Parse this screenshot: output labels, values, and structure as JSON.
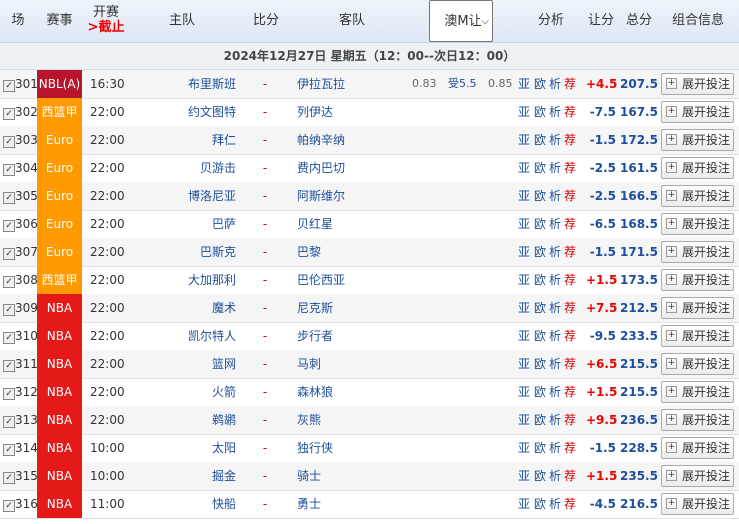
{
  "header": {
    "col_seq": "场",
    "col_league": "赛事",
    "col_kickoff_1": "开赛",
    "col_kickoff_2": ">截止",
    "col_home": "主队",
    "col_score": "比分",
    "col_away": "客队",
    "odds_select": "澳M让",
    "col_analysis": "分析",
    "col_handicap": "让分",
    "col_total": "总分",
    "col_combo": "组合信息"
  },
  "date_band": "2024年12月27日 星期五（12：00--次日12：00）",
  "colors": {
    "nbl": "#b8142b",
    "euro": "#ff9900",
    "xlj": "#ff9900",
    "nba": "#e61919"
  },
  "rows": [
    {
      "num": "301",
      "league": "NBL(A)",
      "color": "#b8142b",
      "time": "16:30",
      "home": "布里斯班",
      "score": "-",
      "away": "伊拉瓦拉",
      "odds_l": "0.83",
      "odds_m": "受5.5",
      "odds_r": "0.85",
      "a1": "亚",
      "a2": "欧",
      "a3": "析",
      "a4": "荐",
      "hc": "+4.5",
      "total": "207.5",
      "btn": "展开投注"
    },
    {
      "num": "302",
      "league": "西篮甲",
      "color": "#ff9900",
      "time": "22:00",
      "home": "约文图特",
      "score": "-",
      "away": "列伊达",
      "odds_l": "",
      "odds_m": "",
      "odds_r": "",
      "a1": "亚",
      "a2": "欧",
      "a3": "析",
      "a4": "荐",
      "hc": "-7.5",
      "total": "167.5",
      "btn": "展开投注"
    },
    {
      "num": "303",
      "league": "Euro",
      "color": "#ff9900",
      "time": "22:00",
      "home": "拜仁",
      "score": "-",
      "away": "帕纳辛纳",
      "odds_l": "",
      "odds_m": "",
      "odds_r": "",
      "a1": "亚",
      "a2": "欧",
      "a3": "析",
      "a4": "荐",
      "hc": "-1.5",
      "total": "172.5",
      "btn": "展开投注"
    },
    {
      "num": "304",
      "league": "Euro",
      "color": "#ff9900",
      "time": "22:00",
      "home": "贝游击",
      "score": "-",
      "away": "费内巴切",
      "odds_l": "",
      "odds_m": "",
      "odds_r": "",
      "a1": "亚",
      "a2": "欧",
      "a3": "析",
      "a4": "荐",
      "hc": "-2.5",
      "total": "161.5",
      "btn": "展开投注"
    },
    {
      "num": "305",
      "league": "Euro",
      "color": "#ff9900",
      "time": "22:00",
      "home": "博洛尼亚",
      "score": "-",
      "away": "阿斯维尔",
      "odds_l": "",
      "odds_m": "",
      "odds_r": "",
      "a1": "亚",
      "a2": "欧",
      "a3": "析",
      "a4": "荐",
      "hc": "-2.5",
      "total": "166.5",
      "btn": "展开投注"
    },
    {
      "num": "306",
      "league": "Euro",
      "color": "#ff9900",
      "time": "22:00",
      "home": "巴萨",
      "score": "-",
      "away": "贝红星",
      "odds_l": "",
      "odds_m": "",
      "odds_r": "",
      "a1": "亚",
      "a2": "欧",
      "a3": "析",
      "a4": "荐",
      "hc": "-6.5",
      "total": "168.5",
      "btn": "展开投注"
    },
    {
      "num": "307",
      "league": "Euro",
      "color": "#ff9900",
      "time": "22:00",
      "home": "巴斯克",
      "score": "-",
      "away": "巴黎",
      "odds_l": "",
      "odds_m": "",
      "odds_r": "",
      "a1": "亚",
      "a2": "欧",
      "a3": "析",
      "a4": "荐",
      "hc": "-1.5",
      "total": "171.5",
      "btn": "展开投注"
    },
    {
      "num": "308",
      "league": "西篮甲",
      "color": "#ff9900",
      "time": "22:00",
      "home": "大加那利",
      "score": "-",
      "away": "巴伦西亚",
      "odds_l": "",
      "odds_m": "",
      "odds_r": "",
      "a1": "亚",
      "a2": "欧",
      "a3": "析",
      "a4": "荐",
      "hc": "+1.5",
      "total": "173.5",
      "btn": "展开投注"
    },
    {
      "num": "309",
      "league": "NBA",
      "color": "#e61919",
      "time": "22:00",
      "home": "魔术",
      "score": "-",
      "away": "尼克斯",
      "odds_l": "",
      "odds_m": "",
      "odds_r": "",
      "a1": "亚",
      "a2": "欧",
      "a3": "析",
      "a4": "荐",
      "hc": "+7.5",
      "total": "212.5",
      "btn": "展开投注"
    },
    {
      "num": "310",
      "league": "NBA",
      "color": "#e61919",
      "time": "22:00",
      "home": "凯尔特人",
      "score": "-",
      "away": "步行者",
      "odds_l": "",
      "odds_m": "",
      "odds_r": "",
      "a1": "亚",
      "a2": "欧",
      "a3": "析",
      "a4": "荐",
      "hc": "-9.5",
      "total": "233.5",
      "btn": "展开投注"
    },
    {
      "num": "311",
      "league": "NBA",
      "color": "#e61919",
      "time": "22:00",
      "home": "篮网",
      "score": "-",
      "away": "马刺",
      "odds_l": "",
      "odds_m": "",
      "odds_r": "",
      "a1": "亚",
      "a2": "欧",
      "a3": "析",
      "a4": "荐",
      "hc": "+6.5",
      "total": "215.5",
      "btn": "展开投注"
    },
    {
      "num": "312",
      "league": "NBA",
      "color": "#e61919",
      "time": "22:00",
      "home": "火箭",
      "score": "-",
      "away": "森林狼",
      "odds_l": "",
      "odds_m": "",
      "odds_r": "",
      "a1": "亚",
      "a2": "欧",
      "a3": "析",
      "a4": "荐",
      "hc": "+1.5",
      "total": "215.5",
      "btn": "展开投注"
    },
    {
      "num": "313",
      "league": "NBA",
      "color": "#e61919",
      "time": "22:00",
      "home": "鹈鹕",
      "score": "-",
      "away": "灰熊",
      "odds_l": "",
      "odds_m": "",
      "odds_r": "",
      "a1": "亚",
      "a2": "欧",
      "a3": "析",
      "a4": "荐",
      "hc": "+9.5",
      "total": "236.5",
      "btn": "展开投注"
    },
    {
      "num": "314",
      "league": "NBA",
      "color": "#e61919",
      "time": "10:00",
      "home": "太阳",
      "score": "-",
      "away": "独行侠",
      "odds_l": "",
      "odds_m": "",
      "odds_r": "",
      "a1": "亚",
      "a2": "欧",
      "a3": "析",
      "a4": "荐",
      "hc": "-1.5",
      "total": "228.5",
      "btn": "展开投注"
    },
    {
      "num": "315",
      "league": "NBA",
      "color": "#e61919",
      "time": "10:00",
      "home": "掘金",
      "score": "-",
      "away": "骑士",
      "odds_l": "",
      "odds_m": "",
      "odds_r": "",
      "a1": "亚",
      "a2": "欧",
      "a3": "析",
      "a4": "荐",
      "hc": "+1.5",
      "total": "235.5",
      "btn": "展开投注"
    },
    {
      "num": "316",
      "league": "NBA",
      "color": "#e61919",
      "time": "11:00",
      "home": "快船",
      "score": "-",
      "away": "勇士",
      "odds_l": "",
      "odds_m": "",
      "odds_r": "",
      "a1": "亚",
      "a2": "欧",
      "a3": "析",
      "a4": "荐",
      "hc": "-4.5",
      "total": "216.5",
      "btn": "展开投注"
    }
  ]
}
